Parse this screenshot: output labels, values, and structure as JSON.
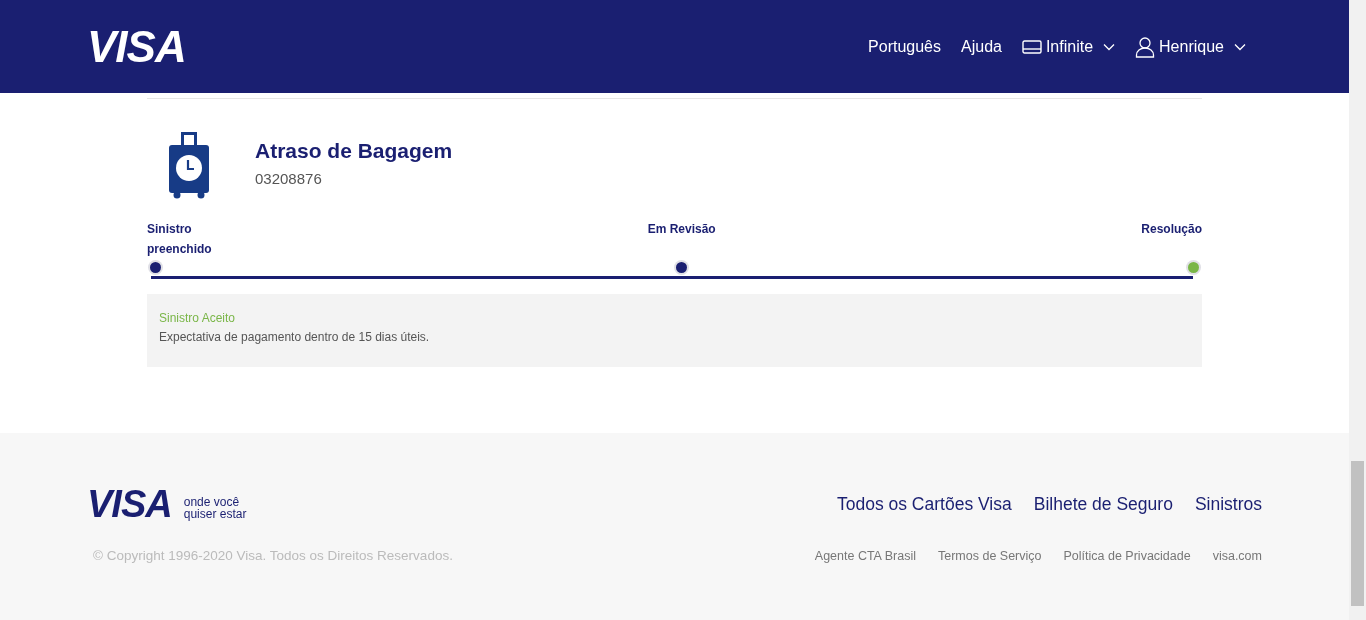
{
  "header": {
    "logo": "VISA",
    "nav": [
      "Português",
      "Ajuda"
    ],
    "card_menu": "Infinite",
    "user_menu": "Henrique"
  },
  "claim": {
    "title": "Atraso de Bagagem",
    "number": "03208876",
    "steps": [
      {
        "label": "Sinistro preenchido",
        "color": "#1a1f71"
      },
      {
        "label": "Em Revisão",
        "color": "#1a1f71"
      },
      {
        "label": "Resolução",
        "color": "#7ab648"
      }
    ],
    "status": {
      "title": "Sinistro Aceito",
      "text": "Expectativa de pagamento dentro de 15 dias úteis."
    }
  },
  "footer": {
    "logo": "VISA",
    "tagline": [
      "onde você",
      "quiser estar"
    ],
    "links": [
      "Todos os Cartões Visa",
      "Bilhete de Seguro",
      "Sinistros"
    ],
    "copyright": "© Copyright 1996-2020 Visa. Todos os Direitos Reservados.",
    "small_links": [
      "Agente CTA Brasil",
      "Termos de Serviço",
      "Política de Privacidade",
      "visa.com"
    ]
  }
}
